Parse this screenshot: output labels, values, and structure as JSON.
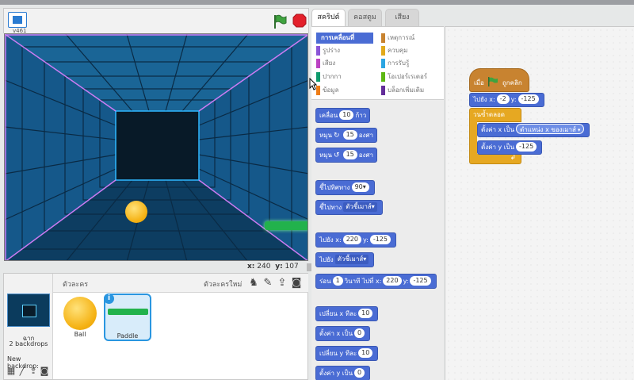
{
  "stage": {
    "version_label": "v461",
    "coords": {
      "x_label": "x:",
      "x_value": "240",
      "y_label": "y:",
      "y_value": "107"
    }
  },
  "sprites_pane": {
    "title": "ตัวละคร",
    "new_sprite_label": "ตัวละครใหม่",
    "stage_name": "ฉาก",
    "backdrops_count": "2 backdrops",
    "new_backdrop_label": "New backdrop:",
    "sprites": [
      {
        "name": "Ball",
        "selected": false
      },
      {
        "name": "Paddle",
        "selected": true
      }
    ],
    "info_badge": "i"
  },
  "tabs": [
    {
      "label": "สคริปต์",
      "active": true
    },
    {
      "label": "คอสตูม",
      "active": false
    },
    {
      "label": "เสียง",
      "active": false
    }
  ],
  "categories": [
    {
      "label": "การเคลื่อนที่",
      "color": "#4a6cd4",
      "selected": true
    },
    {
      "label": "รูปร่าง",
      "color": "#8a55d7",
      "selected": false
    },
    {
      "label": "เสียง",
      "color": "#bb42c3",
      "selected": false
    },
    {
      "label": "ปากกา",
      "color": "#0e9a6c",
      "selected": false
    },
    {
      "label": "ข้อมูล",
      "color": "#ee7d16",
      "selected": false
    },
    {
      "label": "เหตุการณ์",
      "color": "#c88330",
      "selected": false
    },
    {
      "label": "ควบคุม",
      "color": "#e1a91a",
      "selected": false
    },
    {
      "label": "การรับรู้",
      "color": "#2ca5e2",
      "selected": false
    },
    {
      "label": "โอเปอร์เรเตอร์",
      "color": "#5cb712",
      "selected": false
    },
    {
      "label": "บล็อกเพิ่มเติม",
      "color": "#632d99",
      "selected": false
    }
  ],
  "palette": {
    "move": {
      "pre": "เคลื่อน",
      "value": "10",
      "post": "ก้าว"
    },
    "turn_right": {
      "pre": "หมุน",
      "icon": "↻",
      "value": "15",
      "post": "องศา"
    },
    "turn_left": {
      "pre": "หมุน",
      "icon": "↺",
      "value": "15",
      "post": "องศา"
    },
    "point_direction": {
      "pre": "ชี้ไปทิศทาง",
      "value": "90▾"
    },
    "point_towards": {
      "pre": "ชี้ไปทาง",
      "value": "ตัวชี้เมาส์▾"
    },
    "goto_xy": {
      "pre": "ไปยัง",
      "x_label": "x:",
      "x_value": "220",
      "y_label": "y:",
      "y_value": "-125"
    },
    "goto": {
      "pre": "ไปยัง",
      "value": "ตัวชี้เมาส์▾"
    },
    "glide": {
      "pre": "ร่อน",
      "secs": "1",
      "mid": "วินาที ไปที่ x:",
      "x_value": "220",
      "y_label": "y:",
      "y_value": "-125"
    },
    "change_x": {
      "pre": "เปลี่ยน x ทีละ",
      "value": "10"
    },
    "set_x": {
      "pre": "ตั้งค่า x เป็น",
      "value": "0"
    },
    "change_y": {
      "pre": "เปลี่ยน y ทีละ",
      "value": "10"
    },
    "set_y": {
      "pre": "ตั้งค่า y เป็น",
      "value": "0"
    }
  },
  "script": {
    "hat": {
      "pre": "เมื่อ",
      "post": "ถูกคลิก"
    },
    "goto": {
      "pre": "ไปยัง",
      "x_label": "x:",
      "x_value": "-2",
      "y_label": "y:",
      "y_value": "-125"
    },
    "forever": {
      "label": "วนซ้ำตลอด",
      "arrow": "↲"
    },
    "set_x": {
      "pre": "ตั้งค่า x เป็น",
      "reporter": "ตำแหน่ง x ของเมาส์"
    },
    "set_y": {
      "pre": "ตั้งค่า y เป็น",
      "value": "-125"
    }
  },
  "colors": {
    "motion": "#4a6cd4",
    "events": "#c88330",
    "control": "#e6a822",
    "stage_bg": "#0a3a5a"
  }
}
